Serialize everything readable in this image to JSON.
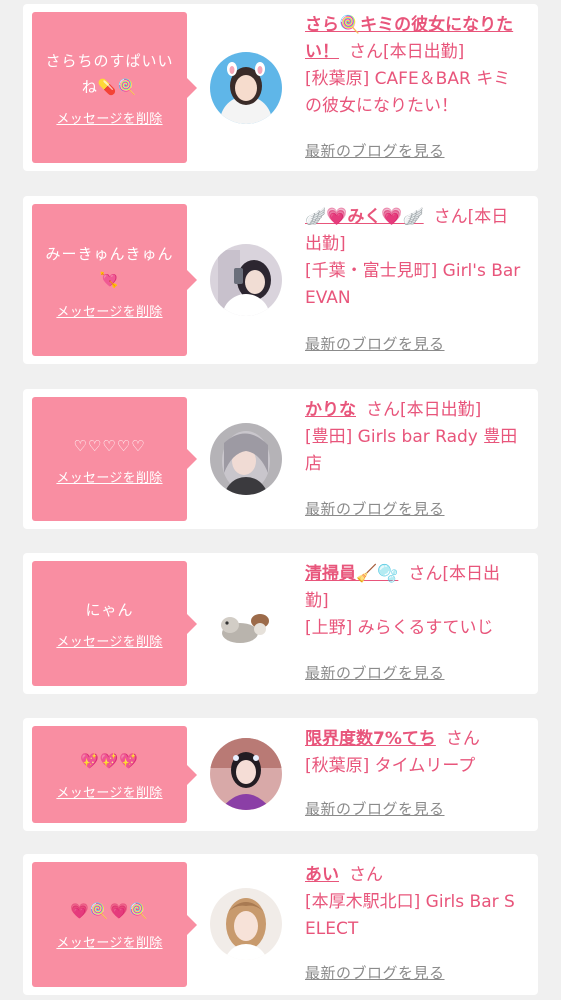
{
  "delete_label": "メッセージを削除",
  "blog_label": "最新のブログを見る",
  "accent_color": "#e8557b",
  "bubble_color": "#f98ea2",
  "items": [
    {
      "message": "さらちのすぱいいね💊🍭",
      "name": "さら🍭キミの彼女になりたい！",
      "status": "さん[本日出勤]",
      "shop": "[秋葉原] CAFE＆BAR キミの彼女になりたい！"
    },
    {
      "message": "みーきゅんきゅん💘",
      "name": "🪽💗みく💗🪽",
      "status": "さん[本日出勤]",
      "shop": "[千葉・富士見町] Girl's Bar EVAN"
    },
    {
      "message": "♡♡♡♡♡",
      "name": "かりな",
      "status": "さん[本日出勤]",
      "shop": "[豊田] Girls bar Rady 豊田店"
    },
    {
      "message": "にゃん",
      "name": "清掃員🧹🫧",
      "status": "さん[本日出勤]",
      "shop": "[上野] みらくるすていじ"
    },
    {
      "message": "💖💖💖",
      "name": "限界度数7%てち",
      "status": "さん",
      "shop": "[秋葉原] タイムリープ"
    },
    {
      "message": "💗🍭💗🍭",
      "name": "あい",
      "status": "さん",
      "shop": "[本厚木駅北口] Girls Bar SELECT"
    }
  ]
}
